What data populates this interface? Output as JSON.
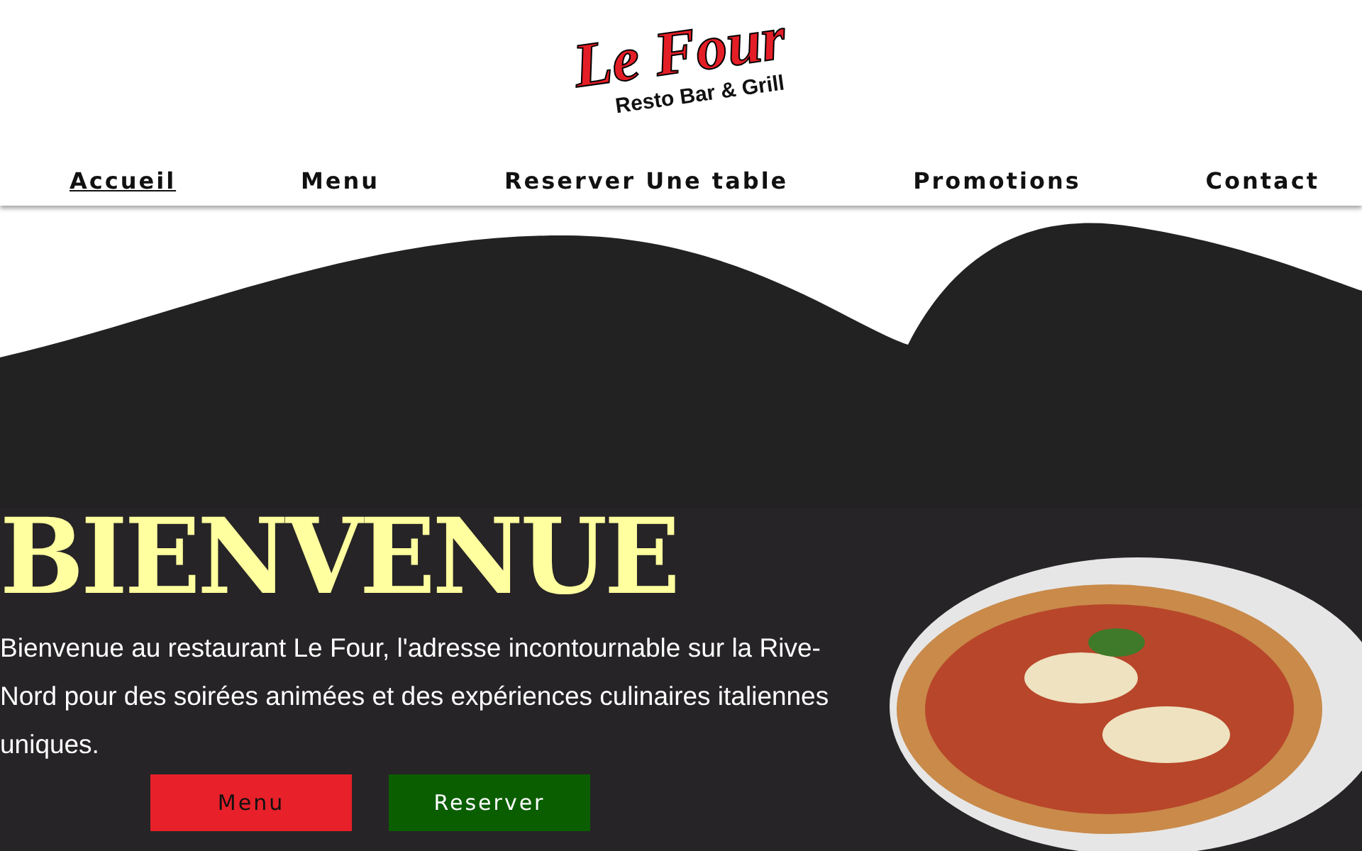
{
  "logo": {
    "title": "Le Four",
    "subtitle": "Resto Bar & Grill"
  },
  "nav": [
    {
      "label": "Accueil",
      "selected": true
    },
    {
      "label": "Menu",
      "selected": false
    },
    {
      "label": "Reserver Une table",
      "selected": false
    },
    {
      "label": "Promotions",
      "selected": false
    },
    {
      "label": "Contact",
      "selected": false
    }
  ],
  "hero": {
    "heading": "BIENVENUE",
    "text": "Bienvenue au restaurant Le Four, l'adresse incontournable sur la Rive-Nord pour des soirées animées et des expériences culinaires italiennes uniques.",
    "buttons": [
      {
        "label": "Menu",
        "kind": "primary"
      },
      {
        "label": "Reserver",
        "kind": "secondary"
      }
    ]
  }
}
